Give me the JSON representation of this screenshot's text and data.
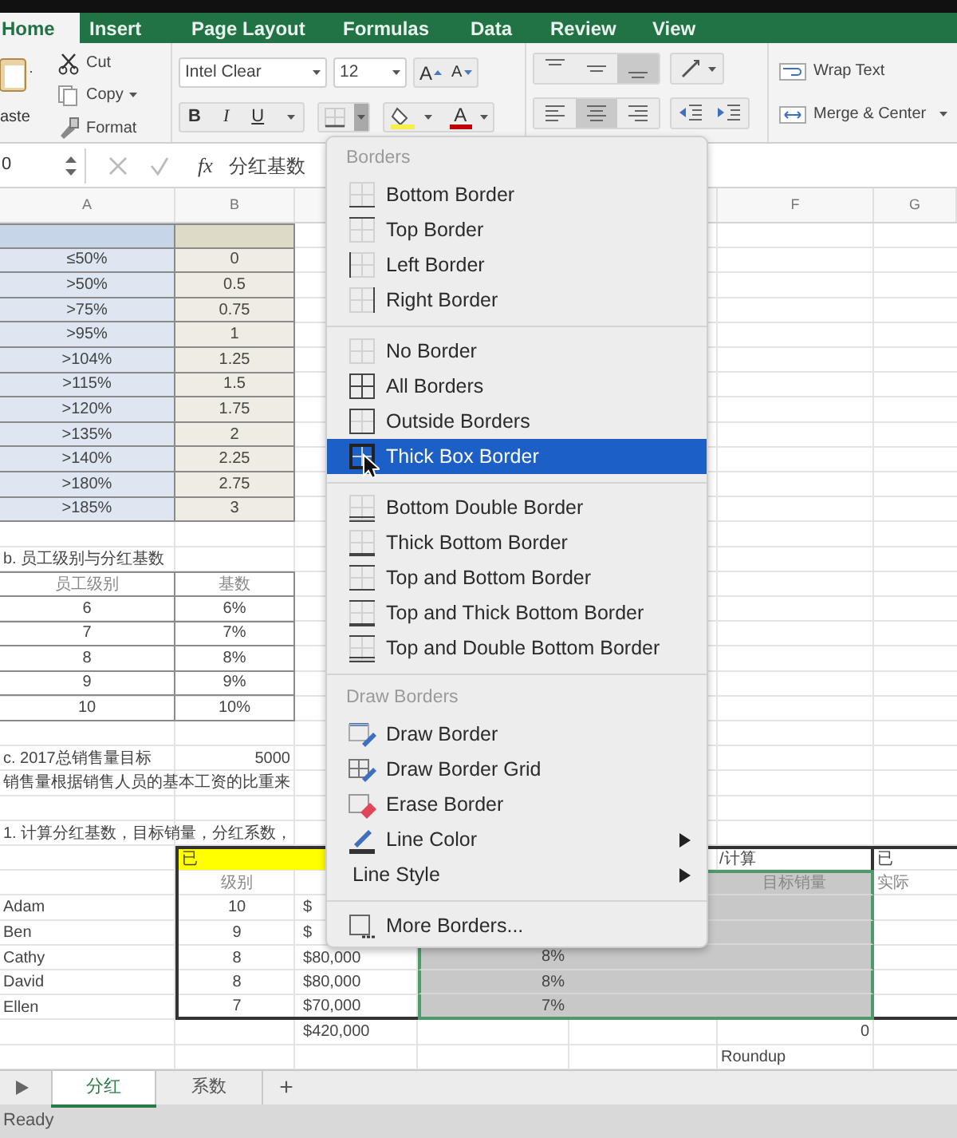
{
  "ribbon_tabs": [
    {
      "label": "Home",
      "selected": true
    },
    {
      "label": "Insert",
      "selected": false
    },
    {
      "label": "Page Layout",
      "selected": false
    },
    {
      "label": "Formulas",
      "selected": false
    },
    {
      "label": "Data",
      "selected": false
    },
    {
      "label": "Review",
      "selected": false
    },
    {
      "label": "View",
      "selected": false
    }
  ],
  "ribbon": {
    "clipboard": {
      "paste": "aste",
      "cut": "Cut",
      "copy": "Copy",
      "format": "Format"
    },
    "font": {
      "name": "Intel Clear",
      "size": "12",
      "grow_label": "A",
      "shrink_label": "A",
      "bold": "B",
      "italic": "I",
      "underline": "U",
      "color_label": "A"
    },
    "borders_dropdown": {
      "expanded": true
    },
    "vertical_align": [
      {
        "selected": false
      },
      {
        "selected": false
      },
      {
        "selected": true
      }
    ],
    "horizontal_align": [
      {
        "selected": false
      },
      {
        "selected": true
      },
      {
        "selected": false
      }
    ],
    "wrap_text": "Wrap Text",
    "merge": "Merge & Center"
  },
  "formula_bar": {
    "name_box": "0",
    "function_label": "fx",
    "content": "分红基数"
  },
  "column_headers": {
    "A": "A",
    "B": "B",
    "F": "F",
    "G": "G"
  },
  "sheet": [
    {
      "kind": "level-header"
    },
    {
      "kind": "level",
      "cells": {
        "A": "≤50%",
        "B": "0"
      }
    },
    {
      "kind": "level",
      "cells": {
        "A": ">50%",
        "B": "0.5"
      }
    },
    {
      "kind": "level",
      "cells": {
        "A": ">75%",
        "B": "0.75"
      }
    },
    {
      "kind": "level",
      "cells": {
        "A": ">95%",
        "B": "1"
      }
    },
    {
      "kind": "level",
      "cells": {
        "A": ">104%",
        "B": "1.25"
      }
    },
    {
      "kind": "level",
      "cells": {
        "A": ">115%",
        "B": "1.5"
      }
    },
    {
      "kind": "level",
      "cells": {
        "A": ">120%",
        "B": "1.75"
      }
    },
    {
      "kind": "level",
      "cells": {
        "A": ">135%",
        "B": "2"
      }
    },
    {
      "kind": "level",
      "cells": {
        "A": ">140%",
        "B": "2.25"
      }
    },
    {
      "kind": "level",
      "cells": {
        "A": ">180%",
        "B": "2.75"
      }
    },
    {
      "kind": "level",
      "cells": {
        "A": ">185%",
        "B": "3"
      }
    },
    {
      "kind": "blank"
    },
    {
      "kind": "title",
      "cells": {
        "A": "b. 员工级别与分红基数"
      }
    },
    {
      "kind": "grade-header",
      "cells": {
        "A": "员工级别",
        "B": "基数"
      }
    },
    {
      "kind": "grade",
      "cells": {
        "A": "6",
        "B": "6%"
      }
    },
    {
      "kind": "grade",
      "cells": {
        "A": "7",
        "B": "7%"
      }
    },
    {
      "kind": "grade",
      "cells": {
        "A": "8",
        "B": "8%"
      }
    },
    {
      "kind": "grade",
      "cells": {
        "A": "9",
        "B": "9%"
      }
    },
    {
      "kind": "grade",
      "cells": {
        "A": "10",
        "B": "10%"
      }
    },
    {
      "kind": "blank"
    },
    {
      "kind": "note",
      "cells": {
        "A": "c. 2017总销售量目标",
        "B": "5000"
      }
    },
    {
      "kind": "title",
      "cells": {
        "A": "销售量根据销售人员的基本工资的比重来"
      }
    },
    {
      "kind": "blank"
    },
    {
      "kind": "title",
      "cells": {
        "A": "1. 计算分红基数，目标销量，分红系数，"
      }
    },
    {
      "kind": "known-header",
      "cells": {
        "B": "已",
        "F": "/计算",
        "G": "已"
      }
    },
    {
      "kind": "known-subheader",
      "selected": true,
      "cells": {
        "B": "级别",
        "F": "目标销量",
        "G": "实际"
      }
    },
    {
      "kind": "person",
      "selected": true,
      "currency": "$",
      "cells": {
        "A": "Adam",
        "B": "10"
      }
    },
    {
      "kind": "person",
      "selected": true,
      "currency": "$",
      "cells": {
        "A": "Ben",
        "B": "9"
      }
    },
    {
      "kind": "person",
      "selected": true,
      "currency": "$",
      "amount": "80,000",
      "cells": {
        "A": "Cathy",
        "B": "8",
        "D": "8%"
      }
    },
    {
      "kind": "person",
      "selected": true,
      "currency": "$",
      "amount": "80,000",
      "cells": {
        "A": "David",
        "B": "8",
        "D": "8%"
      }
    },
    {
      "kind": "person",
      "selected": true,
      "currency": "$",
      "amount": "70,000",
      "cells": {
        "A": "Ellen",
        "B": "7",
        "D": "7%"
      }
    },
    {
      "kind": "total",
      "currency": "$",
      "amount": "420,000",
      "cells": {
        "F": "0"
      }
    },
    {
      "kind": "formula-note",
      "cells": {
        "F": "Roundup"
      }
    }
  ],
  "borders_menu": {
    "sections": [
      {
        "heading": "Borders",
        "items": [
          {
            "label": "Bottom Border",
            "kind": "bottom",
            "selected": false,
            "submenu": false
          },
          {
            "label": "Top Border",
            "kind": "top",
            "selected": false,
            "submenu": false
          },
          {
            "label": "Left Border",
            "kind": "left",
            "selected": false,
            "submenu": false
          },
          {
            "label": "Right Border",
            "kind": "right",
            "selected": false,
            "submenu": false
          }
        ]
      },
      {
        "items": [
          {
            "label": "No Border",
            "kind": "none",
            "selected": false,
            "submenu": false
          },
          {
            "label": "All Borders",
            "kind": "all",
            "selected": false,
            "submenu": false
          },
          {
            "label": "Outside Borders",
            "kind": "outside",
            "selected": false,
            "submenu": false
          },
          {
            "label": "Thick Box Border",
            "kind": "thickbox",
            "selected": true,
            "submenu": false
          }
        ]
      },
      {
        "items": [
          {
            "label": "Bottom Double Border",
            "kind": "bottomdouble",
            "selected": false,
            "submenu": false
          },
          {
            "label": "Thick Bottom Border",
            "kind": "thickbottom",
            "selected": false,
            "submenu": false
          },
          {
            "label": "Top and Bottom Border",
            "kind": "topbottom",
            "selected": false,
            "submenu": false
          },
          {
            "label": "Top and Thick Bottom Border",
            "kind": "topthickbottom",
            "selected": false,
            "submenu": false
          },
          {
            "label": "Top and Double Bottom Border",
            "kind": "topdoublebottom",
            "selected": false,
            "submenu": false
          }
        ]
      },
      {
        "heading": "Draw Borders",
        "items": [
          {
            "label": "Draw Border",
            "kind": "draw",
            "selected": false,
            "submenu": false
          },
          {
            "label": "Draw Border Grid",
            "kind": "drawgrid",
            "selected": false,
            "submenu": false
          },
          {
            "label": "Erase Border",
            "kind": "erase",
            "selected": false,
            "submenu": false
          },
          {
            "label": "Line Color",
            "kind": "linecolor",
            "selected": false,
            "submenu": true
          },
          {
            "label": "Line Style",
            "kind": "plain",
            "selected": false,
            "submenu": true
          }
        ]
      },
      {
        "items": [
          {
            "label": "More Borders...",
            "kind": "more",
            "selected": false,
            "submenu": false
          }
        ]
      }
    ]
  },
  "sheet_tabs": [
    {
      "label": "分红",
      "selected": true
    },
    {
      "label": "系数",
      "selected": false
    }
  ],
  "add_sheet_label": "+",
  "status_bar": "Ready"
}
